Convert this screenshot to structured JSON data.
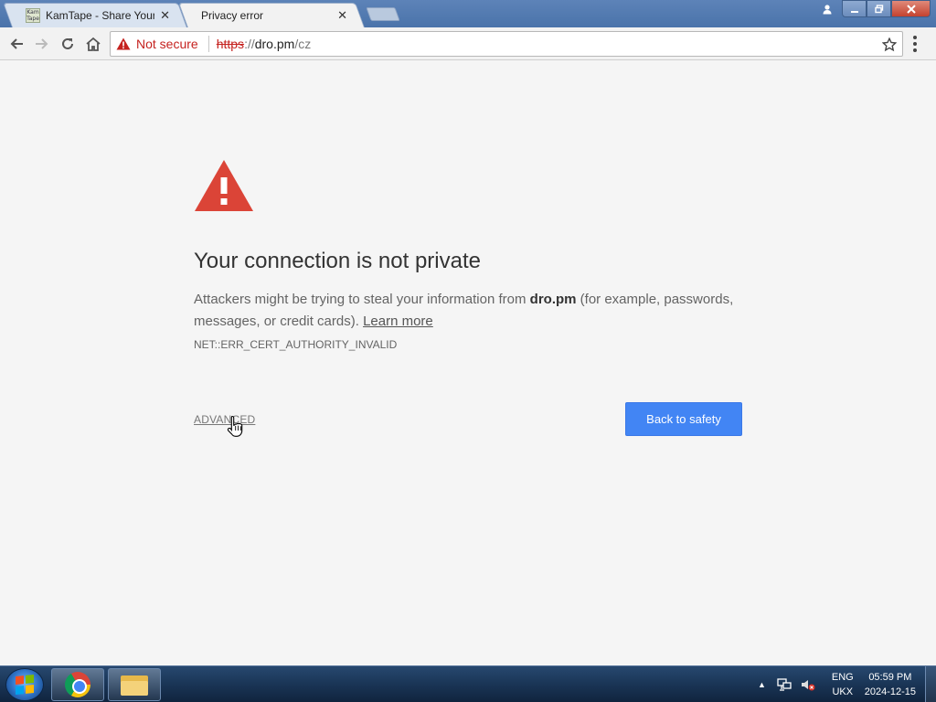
{
  "browser": {
    "tabs": [
      {
        "title": "KamTape - Share Your V",
        "favicon_text": "Kam Tape",
        "active": false
      },
      {
        "title": "Privacy error",
        "active": true
      }
    ],
    "tab_close_glyph": "✕",
    "security_label": "Not secure",
    "url": {
      "scheme": "https",
      "separator": "://",
      "host": "dro.pm",
      "path": "/cz"
    },
    "icons": [
      "back-arrow-icon",
      "forward-arrow-icon",
      "reload-icon",
      "home-icon",
      "warning-icon",
      "star-icon",
      "menu-icon",
      "user-icon"
    ]
  },
  "error_page": {
    "heading": "Your connection is not private",
    "explain_prefix": "Attackers might be trying to steal your information from ",
    "explain_host": "dro.pm",
    "explain_suffix": " (for example, passwords, messages, or credit cards). ",
    "learn_more": "Learn more",
    "error_code": "NET::ERR_CERT_AUTHORITY_INVALID",
    "advanced_label": "ADVANCED",
    "back_button_label": "Back to safety"
  },
  "taskbar": {
    "language": "ENG",
    "layout": "UKX",
    "time": "05:59 PM",
    "date": "2024-12-15"
  },
  "colors": {
    "warning_red": "#db4437",
    "not_secure_red": "#c5221f",
    "button_blue": "#4285f4"
  }
}
